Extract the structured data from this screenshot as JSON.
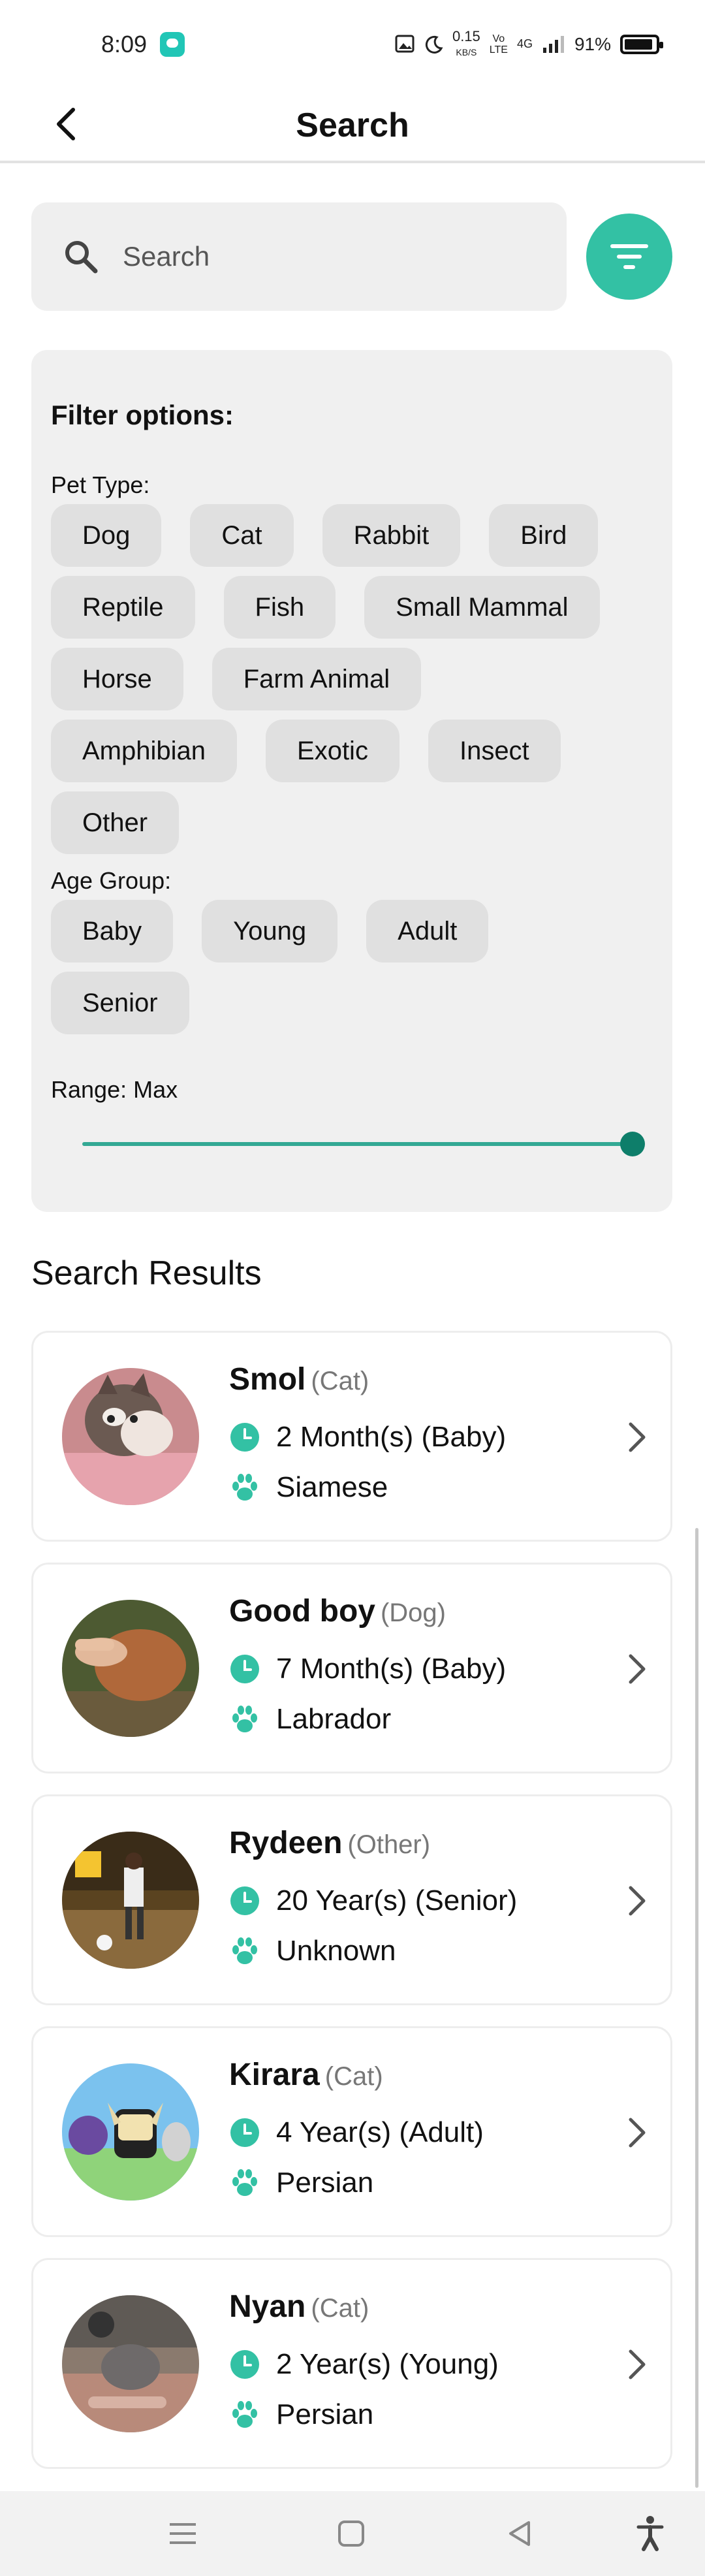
{
  "status_bar": {
    "time": "8:09",
    "speed_value": "0.15",
    "speed_unit": "KB/S",
    "volte_top": "Vo",
    "volte_bottom": "LTE",
    "network": "4G",
    "battery": "91%",
    "battery_level": 0.91
  },
  "app_bar": {
    "title": "Search",
    "back_icon": "back-arrow-icon"
  },
  "search": {
    "placeholder": "Search",
    "value": "",
    "filter_icon": "filter-icon"
  },
  "filter_options": {
    "heading": "Filter options:",
    "pet_type_label": "Pet Type:",
    "pet_types": [
      "Dog",
      "Cat",
      "Rabbit",
      "Bird",
      "Reptile",
      "Fish",
      "Small Mammal",
      "Horse",
      "Farm Animal",
      "Amphibian",
      "Exotic",
      "Insect",
      "Other"
    ],
    "age_group_label": "Age Group:",
    "age_groups": [
      "Baby",
      "Young",
      "Adult",
      "Senior"
    ],
    "range_label": "Range: Max",
    "range_value": 1.0
  },
  "results": {
    "title": "Search Results",
    "items": [
      {
        "name": "Smol",
        "type": "(Cat)",
        "age": "2 Month(s) (Baby)",
        "breed": "Siamese"
      },
      {
        "name": "Good boy",
        "type": "(Dog)",
        "age": "7 Month(s) (Baby)",
        "breed": "Labrador"
      },
      {
        "name": "Rydeen",
        "type": "(Other)",
        "age": "20 Year(s) (Senior)",
        "breed": "Unknown"
      },
      {
        "name": "Kirara",
        "type": "(Cat)",
        "age": "4 Year(s) (Adult)",
        "breed": "Persian"
      },
      {
        "name": "Nyan",
        "type": "(Cat)",
        "age": "2 Year(s) (Young)",
        "breed": "Persian"
      }
    ]
  },
  "colors": {
    "accent": "#33c1a4",
    "slider": "#33a994",
    "chip_bg": "#e0e0e0",
    "panel_bg": "#f0f0f0"
  }
}
